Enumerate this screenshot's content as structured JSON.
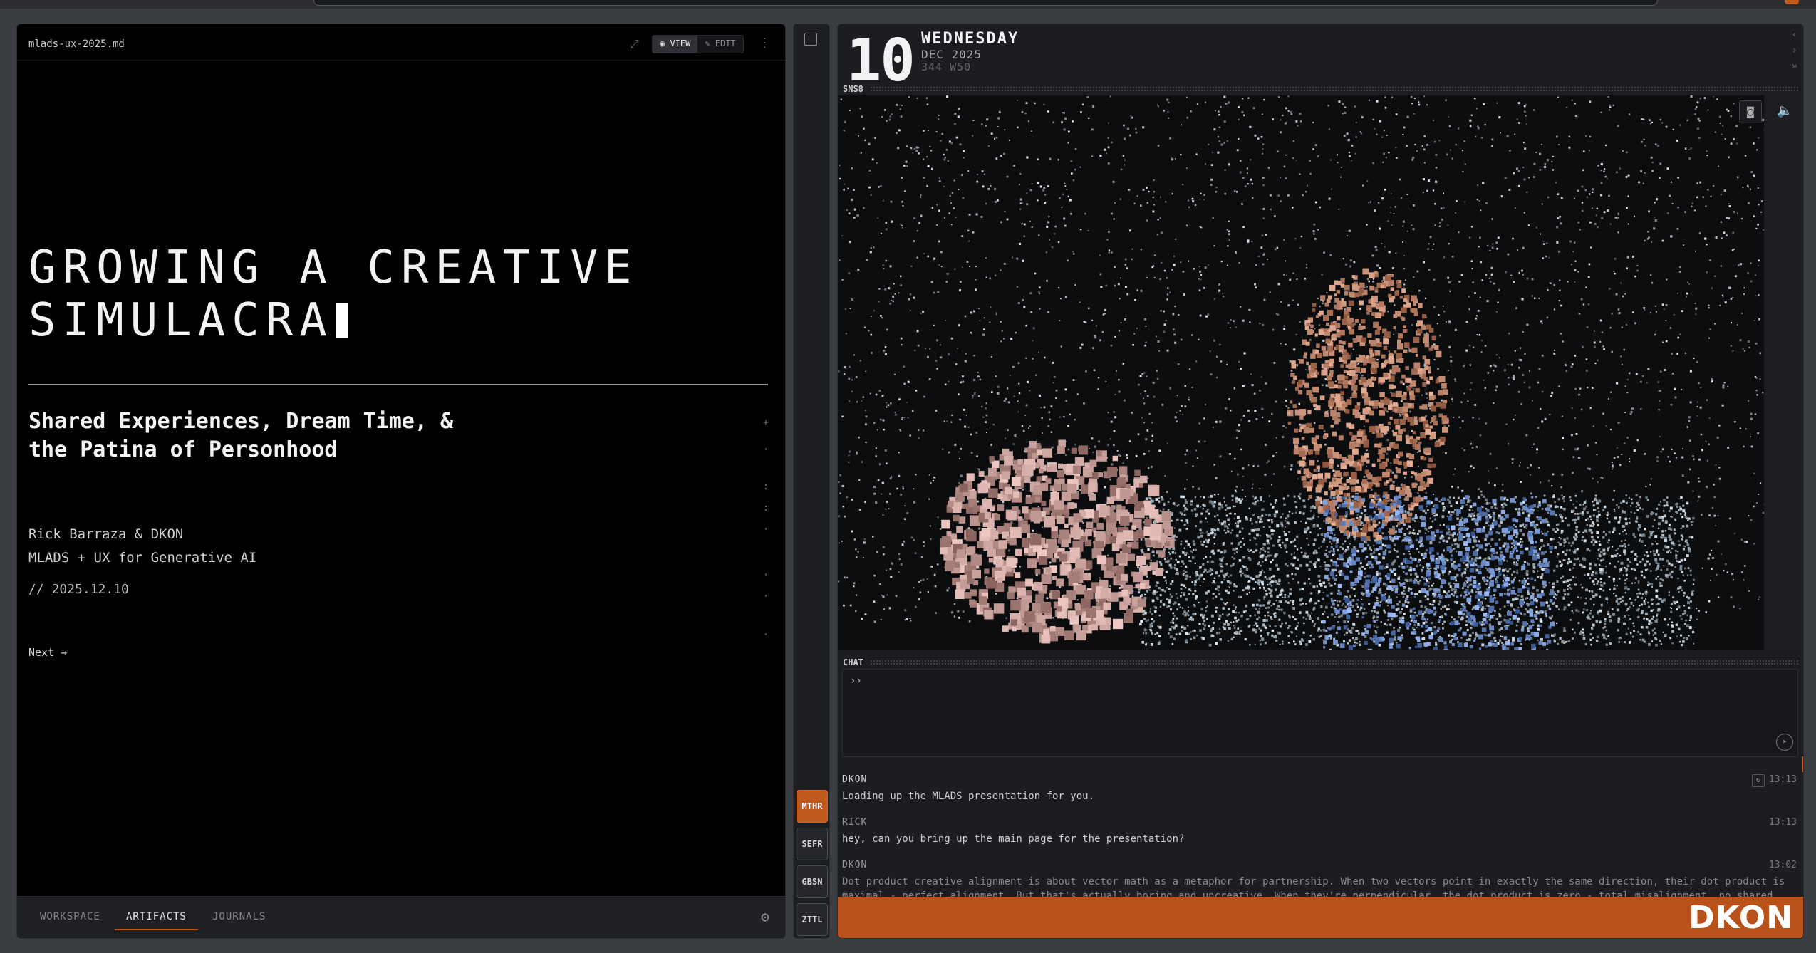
{
  "left_panel": {
    "filename": "mlads-ux-2025.md",
    "view_label": "VIEW",
    "edit_label": "EDIT",
    "slide": {
      "title_line1": "GROWING A CREATIVE",
      "title_line2": "SIMULACRA",
      "subtitle_line1": "Shared Experiences, Dream Time, &",
      "subtitle_line2": "the Patina of Personhood",
      "author_line1": "Rick Barraza & DKON",
      "author_line2": "MLADS + UX for Generative AI",
      "date": "// 2025.12.10",
      "next": "Next →"
    },
    "tabs": [
      {
        "label": "WORKSPACE"
      },
      {
        "label": "ARTIFACTS"
      },
      {
        "label": "JOURNALS"
      }
    ],
    "active_tab": "ARTIFACTS"
  },
  "rail": {
    "buttons": [
      {
        "label": "MTHR"
      },
      {
        "label": "SEFR"
      },
      {
        "label": "GBSN"
      },
      {
        "label": "ZTTL"
      }
    ],
    "active": "MTHR"
  },
  "right_panel": {
    "date": {
      "day": "10",
      "weekday": "WEDNESDAY",
      "month_year": "DEC 2025",
      "day_week": "344 W50"
    },
    "feed_label": "SNS8",
    "chat_label": "CHAT",
    "chat_prompt": "››",
    "messages": [
      {
        "author": "DKON",
        "text": "Loading up the MLADS presentation for you.",
        "time": "13:13"
      },
      {
        "author": "RICK",
        "text": "hey, can you bring up the main page for the presentation?",
        "time": "13:13"
      },
      {
        "author": "DKON",
        "text": "Dot product creative alignment is about vector math as a metaphor for partnership. When two vectors point in exactly the same direction, their dot product is",
        "text2": "maximal - perfect alignment. But that's actually boring and uncreative. When they're perpendicular, the dot product is zero - total misalignment, no shared",
        "time": "13:02"
      }
    ],
    "brand": "DKON"
  },
  "colors": {
    "accent": "#c25a1e",
    "panel_bg": "#1b1d21",
    "slide_bg": "#000000"
  },
  "icons": [
    "expand-icon",
    "eye-icon",
    "pencil-icon",
    "kebab-icon",
    "gear-icon",
    "sidebar-toggle-icon",
    "camera-icon",
    "speaker-icon",
    "send-icon",
    "refresh-icon"
  ]
}
